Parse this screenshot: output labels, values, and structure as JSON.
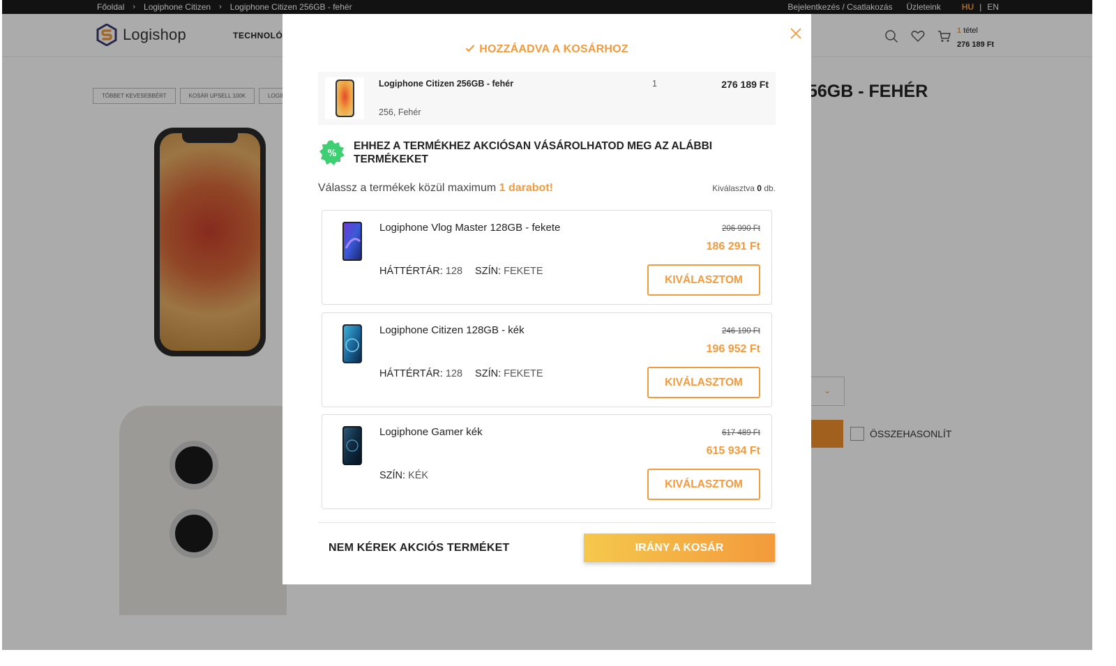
{
  "breadcrumb": {
    "items": [
      "Főoldal",
      "Logiphone Citizen",
      "Logiphone Citizen 256GB - fehér"
    ]
  },
  "topbar": {
    "login": "Bejelentkezés / Csatlakozás",
    "stores": "Üzleteink",
    "lang_hu": "HU",
    "lang_sep": "|",
    "lang_en": "EN"
  },
  "header": {
    "logo": "Logishop",
    "nav_technology": "TECHNOLÓG",
    "cart_count": "1",
    "cart_count_label": "tétel",
    "cart_total": "276 189 Ft"
  },
  "page": {
    "tags": [
      "TÖBBET KEVESEBBÉRT",
      "KOSÁR UPSELL 100K",
      "LOGIPHO"
    ],
    "title_visible": "56GB - FEHÉR",
    "compare_label": "ÖSSZEHASONLÍT"
  },
  "modal": {
    "added_title": "HOZZÁADVA A KOSÁRHOZ",
    "added_item": {
      "name": "Logiphone Citizen 256GB - fehér",
      "attr_storage": "256,",
      "attr_color": "Fehér",
      "qty": "1",
      "price": "276 189 Ft"
    },
    "promo_title_line1": "EHHEZ A TERMÉKHEZ AKCIÓSAN VÁSÁROLHATOD MEG AZ ALÁBBI",
    "promo_title_line2": "TERMÉKEKET",
    "promo_badge": "%",
    "choose_text": "Válassz a termékek közül maximum",
    "choose_highlight": "1 darabot!",
    "selected_label": "Kiválasztva",
    "selected_count": "0",
    "selected_unit": "db.",
    "products": [
      {
        "name": "Logiphone Vlog Master 128GB - fekete",
        "old_price": "206 990 Ft",
        "new_price": "186 291 Ft",
        "storage_key": "HÁTTÉRTÁR:",
        "storage_val": "128",
        "color_key": "SZÍN:",
        "color_val": "FEKETE",
        "button": "KIVÁLASZTOM"
      },
      {
        "name": "Logiphone Citizen 128GB - kék",
        "old_price": "246 190 Ft",
        "new_price": "196 952 Ft",
        "storage_key": "HÁTTÉRTÁR:",
        "storage_val": "128",
        "color_key": "SZÍN:",
        "color_val": "FEKETE",
        "button": "KIVÁLASZTOM"
      },
      {
        "name": "Logiphone Gamer kék",
        "old_price": "617 489 Ft",
        "new_price": "615 934 Ft",
        "color_key": "SZÍN:",
        "color_val": "KÉK",
        "button": "KIVÁLASZTOM"
      }
    ],
    "decline": "NEM KÉREK AKCIÓS TERMÉKET",
    "to_cart": "IRÁNY A KOSÁR"
  },
  "colors": {
    "accent": "#f39a3c",
    "promo_badge": "#3ecf72",
    "topbar": "#1b1b1b"
  }
}
